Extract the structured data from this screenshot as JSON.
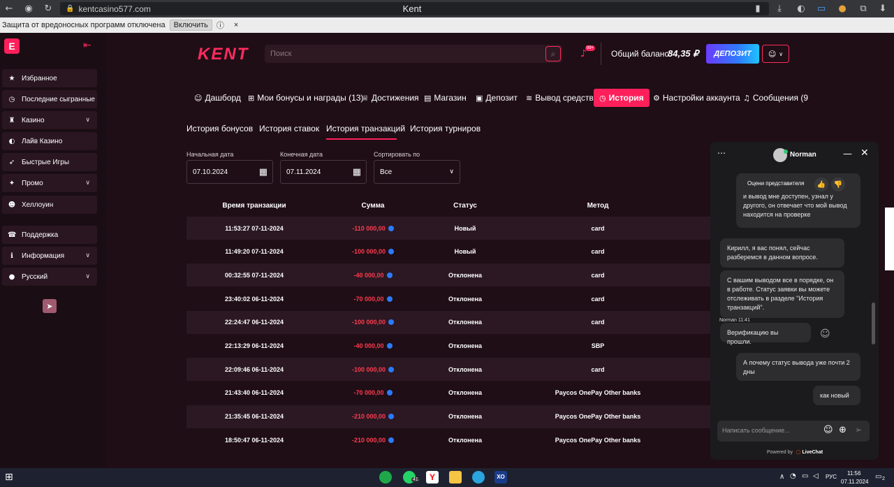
{
  "browser": {
    "url": "kentcasino577.com",
    "title": "Kent",
    "infobar_text": "Защита от вредоносных программ отключена",
    "infobar_button": "Включить",
    "infobar_close": "×"
  },
  "sidebar": {
    "logo": "E",
    "items": [
      {
        "label": "Избранное",
        "icon": "★"
      },
      {
        "label": "Последние сыгранные",
        "icon": "◷"
      },
      {
        "label": "Казино",
        "icon": "♜",
        "chevron": true
      },
      {
        "label": "Лайв Казино",
        "icon": "◐"
      },
      {
        "label": "Быстрые Игры",
        "icon": "➶"
      },
      {
        "label": "Промо",
        "icon": "✦",
        "chevron": true
      },
      {
        "label": "Хеллоуин",
        "icon": "☻"
      },
      {
        "label": "Поддержка",
        "icon": "☎"
      },
      {
        "label": "Информация",
        "icon": "ℹ",
        "chevron": true
      },
      {
        "label": "Русский",
        "icon": "●",
        "chevron": true
      }
    ]
  },
  "header": {
    "logo": "KENT",
    "search_placeholder": "Поиск",
    "notif_badge": "99+",
    "balance_label": "Общий баланс:",
    "balance_value": "84,35 ₽",
    "deposit_label": "ДЕПОЗИТ"
  },
  "nav_tabs": [
    {
      "label": "Дашборд",
      "icon": "☺"
    },
    {
      "label": "Мои бонусы и награды (13)",
      "icon": "⊞"
    },
    {
      "label": "Достижения",
      "icon": "♕"
    },
    {
      "label": "Магазин",
      "icon": "▤"
    },
    {
      "label": "Депозит",
      "icon": "▣"
    },
    {
      "label": "Вывод средств",
      "icon": "≋"
    },
    {
      "label": "История",
      "icon": "◷",
      "active": true
    },
    {
      "label": "Настройки аккаунта",
      "icon": "⚙"
    },
    {
      "label": "Сообщения (9",
      "icon": "♫"
    }
  ],
  "sub_tabs": [
    "История бонусов",
    "История ставок",
    "История транзакций",
    "История турниров"
  ],
  "filters": {
    "start_label": "Начальная дата",
    "start_value": "07.10.2024",
    "end_label": "Конечная дата",
    "end_value": "07.11.2024",
    "sort_label": "Сортировать по",
    "sort_value": "Все"
  },
  "table": {
    "headers": [
      "Время транзакции",
      "Сумма",
      "Статус",
      "Метод"
    ],
    "rows": [
      [
        "11:53:27 07-11-2024",
        "-110 000,00",
        "Новый",
        "card"
      ],
      [
        "11:49:20 07-11-2024",
        "-100 000,00",
        "Новый",
        "card"
      ],
      [
        "00:32:55 07-11-2024",
        "-40 000,00",
        "Отклонена",
        "card"
      ],
      [
        "23:40:02 06-11-2024",
        "-70 000,00",
        "Отклонена",
        "card"
      ],
      [
        "22:24:47 06-11-2024",
        "-100 000,00",
        "Отклонена",
        "card"
      ],
      [
        "22:13:29 06-11-2024",
        "-40 000,00",
        "Отклонена",
        "SBP"
      ],
      [
        "22:09:46 06-11-2024",
        "-100 000,00",
        "Отклонена",
        "card"
      ],
      [
        "21:43:40 06-11-2024",
        "-70 000,00",
        "Отклонена",
        "Paycos OnePay Other banks"
      ],
      [
        "21:35:45 06-11-2024",
        "-210 000,00",
        "Отклонена",
        "Paycos OnePay Other banks"
      ],
      [
        "18:50:47 06-11-2024",
        "-210 000,00",
        "Отклонена",
        "Paycos OnePay Other banks"
      ]
    ]
  },
  "chat": {
    "agent": "Norman",
    "rate_label": "Оцени представителя",
    "messages": [
      {
        "text": "и вывод мне доступен, узнал у другого, он отвечает что мой вывод находится на проверке",
        "from": "user"
      },
      {
        "text": "Кирилл, я вас понял, сейчас разберемся в данном вопросе.",
        "from": "agent"
      },
      {
        "text": "С вашим выводом все в порядке, он в работе. Статус заявки вы можете отслеживать в разделе \"История транзакций\".",
        "from": "agent"
      },
      {
        "text": "Верификацию вы прошли.",
        "from": "agent"
      },
      {
        "text": "А почему статус вывода уже почти 2 дны",
        "from": "user"
      },
      {
        "text": "как новый",
        "from": "user"
      }
    ],
    "agent_stamp": "Norman 11:41",
    "input_placeholder": "Написать сообщение...",
    "powered_by": "Powered by",
    "brand": "LiveChat"
  },
  "taskbar": {
    "lang": "РУС",
    "time": "11:56",
    "date": "07.11.2024",
    "whatsapp_badge": "41",
    "notif_count": "2"
  }
}
